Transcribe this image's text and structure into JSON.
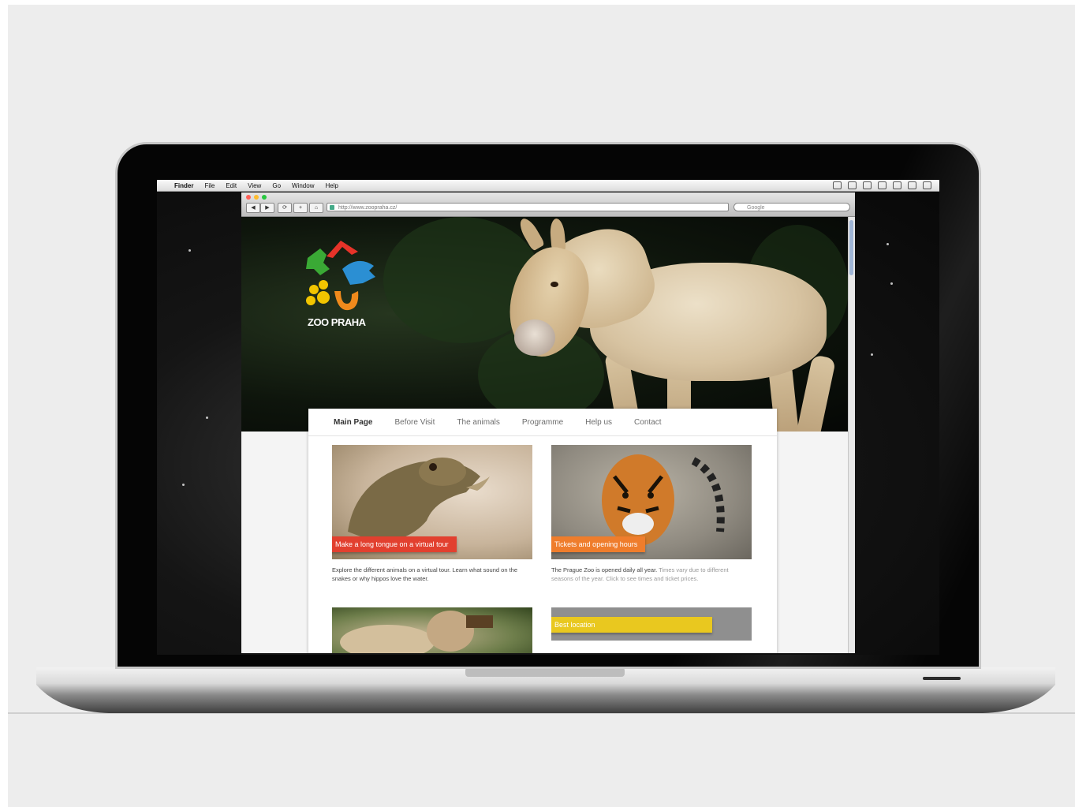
{
  "menubar": {
    "apple": "",
    "app_name": "Finder",
    "items": [
      "File",
      "Edit",
      "View",
      "Go",
      "Window",
      "Help"
    ]
  },
  "browser": {
    "url": "http://www.zoopraha.cz/",
    "search_placeholder": "Google",
    "nav_buttons": [
      "◀",
      "▶",
      "⟳",
      "+",
      "⌂"
    ],
    "colors": {
      "close": "#ff5f57",
      "minimize": "#febc2e",
      "zoom": "#28c840"
    }
  },
  "site": {
    "logo_text": "ZOO PRAHA",
    "nav": [
      "Main Page",
      "Before Visit",
      "The animals",
      "Programme",
      "Help us",
      "Contact"
    ],
    "active_nav": "Main Page",
    "cards": [
      {
        "ribbon": "Make a long tongue on a virtual tour",
        "ribbon_color": "#e2402f",
        "text": "Explore the different animals on a virtual tour. Learn what sound on the snakes or why hippos love the water.",
        "muted": ""
      },
      {
        "ribbon": "Tickets and opening hours",
        "ribbon_color": "#ef7d2c",
        "text": "The Prague Zoo is opened daily all year.",
        "muted": "Times vary due to different seasons of the year. Click to see times and ticket prices."
      },
      {
        "ribbon": "",
        "ribbon_color": ""
      },
      {
        "ribbon": "Best location",
        "ribbon_color": "#e9c81f"
      }
    ]
  }
}
